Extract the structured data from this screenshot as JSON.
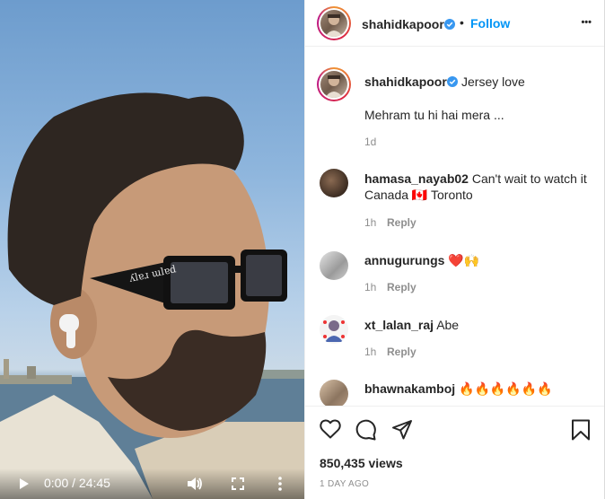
{
  "post": {
    "username": "shahidkapoor",
    "follow_label": "Follow",
    "separator": "•",
    "more_label": "•••"
  },
  "caption": {
    "username": "shahidkapoor",
    "title": "Jersey love",
    "text": "Mehram tu hi hai mera ...",
    "age": "1d"
  },
  "comments": [
    {
      "username": "hamasa_nayab02",
      "text": "Can't wait to watch it",
      "text2": "Canada 🇨🇦 Toronto",
      "age": "1h",
      "reply_label": "Reply"
    },
    {
      "username": "annugurungs",
      "text": "❤️🙌",
      "age": "1h",
      "reply_label": "Reply"
    },
    {
      "username": "xt_lalan_raj",
      "text": "Abe",
      "age": "1h",
      "reply_label": "Reply"
    },
    {
      "username": "bhawnakamboj",
      "text": "🔥🔥🔥🔥🔥🔥",
      "age": "",
      "reply_label": ""
    }
  ],
  "stats": {
    "views": "850,435 views",
    "posted": "1 DAY AGO"
  },
  "video": {
    "time": "0:00 / 24:45"
  },
  "colors": {
    "accent": "#0095f6",
    "verified": "#3897f0",
    "muted": "#8e8e8e"
  },
  "icons": [
    "play-icon",
    "volume-icon",
    "fullscreen-icon",
    "video-more-icon",
    "verified-icon",
    "heart-icon",
    "comment-icon",
    "share-icon",
    "bookmark-icon",
    "more-options-icon"
  ]
}
